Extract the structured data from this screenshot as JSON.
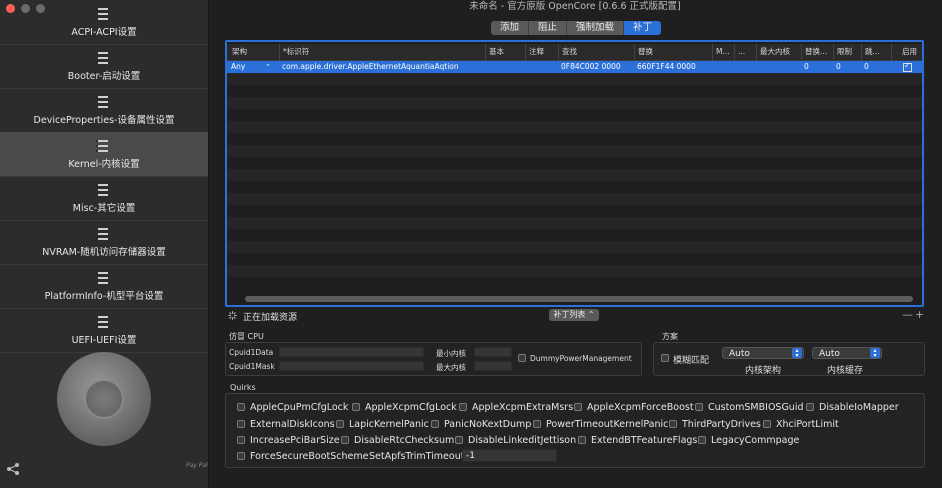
{
  "window": {
    "title": "未命名 - 官方原版 OpenCore [0.6.6 正式版配置]"
  },
  "sidebar": {
    "items": [
      {
        "label": "ACPI-ACPI设置",
        "icon": "list-icon"
      },
      {
        "label": "Booter-启动设置",
        "icon": "list-icon"
      },
      {
        "label": "DeviceProperties-设备属性设置",
        "icon": "list-icon"
      },
      {
        "label": "Kernel-内核设置",
        "icon": "list-icon",
        "active": true
      },
      {
        "label": "Misc-其它设置",
        "icon": "list-icon"
      },
      {
        "label": "NVRAM-随机访问存储器设置",
        "icon": "list-icon"
      },
      {
        "label": "PlatformInfo-机型平台设置",
        "icon": "list-icon"
      },
      {
        "label": "UEFI-UEFI设置",
        "icon": "list-icon"
      }
    ],
    "paypal_label": "Pay Pal"
  },
  "tabs": [
    {
      "label": "添加"
    },
    {
      "label": "阻止"
    },
    {
      "label": "强制加载"
    },
    {
      "label": "补丁",
      "active": true
    }
  ],
  "table": {
    "headers": [
      "架构",
      "*标识符",
      "基本",
      "注释",
      "查找",
      "替换",
      "M...",
      "...",
      "最大内核",
      "替换...",
      "限制",
      "跳...",
      "启用"
    ],
    "rows": [
      {
        "arch": "Any",
        "identifier": "com.apple.driver.AppleEthernetAquantiaAqtion",
        "base": "",
        "comment": "",
        "find": "0F84C002 0000",
        "replace": "660F1F44 0000",
        "count": "0",
        "limit": "0",
        "skip": "0",
        "enabled": true
      }
    ]
  },
  "status": {
    "loading_text": "正在加载资源",
    "patch_list_label": "补丁列表",
    "add_remove": "—+"
  },
  "cpu": {
    "section_label": "仿冒 CPU",
    "cpuid1data_label": "Cpuid1Data",
    "cpuid1mask_label": "Cpuid1Mask",
    "min_kernel_label": "最小内核",
    "max_kernel_label": "最大内核",
    "dummy_power_label": "DummyPowerManagement",
    "cpuid1data_value": "",
    "cpuid1mask_value": "",
    "min_kernel_value": "",
    "max_kernel_value": ""
  },
  "scheme": {
    "section_label": "方案",
    "fuzzy_match_label": "模糊匹配",
    "kernel_arch_value": "Auto",
    "kernel_arch_label": "内核架构",
    "kernel_cache_value": "Auto",
    "kernel_cache_label": "内核缓存"
  },
  "quirks": {
    "section_label": "Quirks",
    "row1": [
      "AppleCpuPmCfgLock",
      "AppleXcpmCfgLock",
      "AppleXcpmExtraMsrs",
      "AppleXcpmForceBoost",
      "CustomSMBIOSGuid",
      "DisableIoMapper"
    ],
    "row2": [
      "ExternalDiskIcons",
      "LapicKernelPanic",
      "PanicNoKextDump",
      "PowerTimeoutKernelPanic",
      "ThirdPartyDrives",
      "XhciPortLimit"
    ],
    "row3": [
      "IncreasePciBarSize",
      "DisableRtcChecksum",
      "DisableLinkeditJettison",
      "ExtendBTFeatureFlags",
      "LegacyCommpage"
    ],
    "row4": [
      "ForceSecureBootScheme"
    ],
    "apfs_trim_label": "SetApfsTrimTimeout",
    "apfs_trim_value": "-1"
  }
}
